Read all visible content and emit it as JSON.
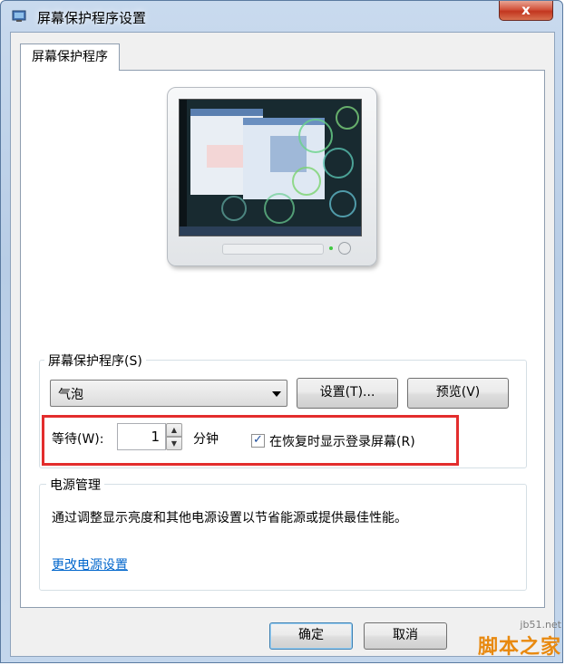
{
  "window": {
    "title": "屏幕保护程序设置",
    "close_glyph": "x"
  },
  "tabs": [
    {
      "label": "屏幕保护程序"
    }
  ],
  "screensaver": {
    "group_label": "屏幕保护程序(S)",
    "selected": "气泡",
    "settings_button": "设置(T)...",
    "preview_button": "预览(V)",
    "wait_label": "等待(W):",
    "wait_value": "1",
    "minutes_label": "分钟",
    "resume_checkbox_label": "在恢复时显示登录屏幕(R)",
    "resume_checked": true
  },
  "power": {
    "group_label": "电源管理",
    "description": "通过调整显示亮度和其他电源设置以节省能源或提供最佳性能。",
    "link": "更改电源设置"
  },
  "footer": {
    "ok_button": "确定",
    "cancel_button": "取消"
  },
  "watermark": {
    "site": "jb51.net",
    "text": "脚本之家"
  },
  "colors": {
    "highlight_border": "#e32d2d",
    "link": "#0066cc",
    "close_button": "#c2361f"
  }
}
